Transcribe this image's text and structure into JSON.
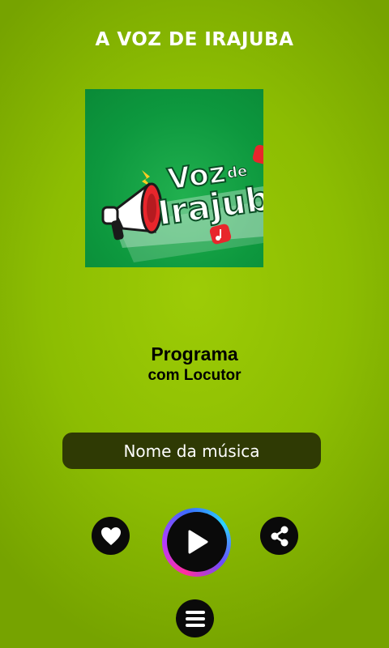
{
  "header": {
    "title": "A VOZ DE IRAJUBA"
  },
  "cover": {
    "logo_line1": "Voz",
    "logo_de": "de",
    "logo_line2": "Irajuba",
    "background_color": "#0d983e"
  },
  "now_playing": {
    "program": "Programa",
    "host": "com Locutor",
    "song": "Nome da música"
  },
  "controls": {
    "like_icon": "heart-icon",
    "play_icon": "play-icon",
    "share_icon": "share-icon",
    "menu_icon": "menu-icon"
  },
  "colors": {
    "background": "#8cbd02",
    "song_box": "#2f3a04",
    "button": "#0a0a0a",
    "text_light": "#ffffff"
  }
}
